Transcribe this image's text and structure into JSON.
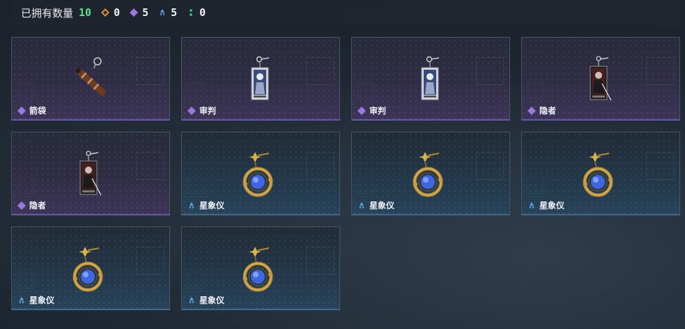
{
  "header": {
    "title": "已拥有数量",
    "total": "10",
    "stats": [
      {
        "icon": "orange-diamond-icon",
        "color": "#d9893a",
        "value": "0"
      },
      {
        "icon": "purple-diamond-icon",
        "color": "#9b78e0",
        "value": "5"
      },
      {
        "icon": "blue-triangle-icon",
        "color": "#5aa6e8",
        "value": "5"
      },
      {
        "icon": "green-dots-icon",
        "color": "#46d08a",
        "value": "0"
      }
    ]
  },
  "items": [
    {
      "name": "箭袋",
      "rarity": "purple",
      "art": "quiver"
    },
    {
      "name": "审判",
      "rarity": "purple",
      "art": "judgment"
    },
    {
      "name": "审判",
      "rarity": "purple",
      "art": "judgment"
    },
    {
      "name": "隐者",
      "rarity": "purple",
      "art": "hermit"
    },
    {
      "name": "隐者",
      "rarity": "purple",
      "art": "hermit"
    },
    {
      "name": "星象仪",
      "rarity": "blue",
      "art": "astrolabe"
    },
    {
      "name": "星象仪",
      "rarity": "blue",
      "art": "astrolabe"
    },
    {
      "name": "星象仪",
      "rarity": "blue",
      "art": "astrolabe"
    },
    {
      "name": "星象仪",
      "rarity": "blue",
      "art": "astrolabe"
    },
    {
      "name": "星象仪",
      "rarity": "blue",
      "art": "astrolabe"
    }
  ]
}
